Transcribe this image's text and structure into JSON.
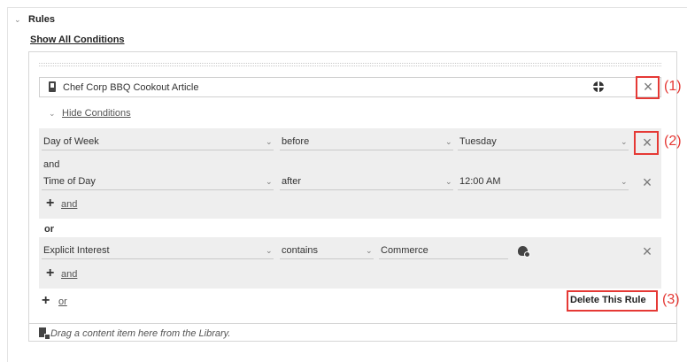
{
  "section": {
    "title": "Rules",
    "show_all_label": "Show All Conditions"
  },
  "rule": {
    "content_item_title": "Chef Corp BBQ Cookout Article",
    "hide_conditions_label": "Hide Conditions",
    "group1": {
      "conditions": [
        {
          "field": "Day of Week",
          "operator": "before",
          "value": "Tuesday"
        },
        {
          "field": "Time of Day",
          "operator": "after",
          "value": "12:00 AM"
        }
      ],
      "joiner": "and",
      "add_and_label": "and"
    },
    "or_label": "or",
    "group2": {
      "conditions": [
        {
          "field": "Explicit Interest",
          "operator": "contains",
          "value": "Commerce"
        }
      ],
      "add_and_label": "and"
    },
    "add_or_label": "or",
    "delete_label": "Delete This Rule",
    "drag_hint": "Drag a content item here from the Library."
  },
  "callouts": {
    "c1": "(1)",
    "c2": "(2)",
    "c3": "(3)"
  },
  "colors": {
    "callout_red": "#e53935",
    "group_bg": "#eeeeee"
  },
  "icons": {
    "content": "phone-icon",
    "language": "globe-icon",
    "close": "close-icon",
    "add": "plus-icon",
    "collapse": "chevron-down-icon",
    "drag": "content-drag-icon",
    "personalize": "lightbulb-icon"
  }
}
